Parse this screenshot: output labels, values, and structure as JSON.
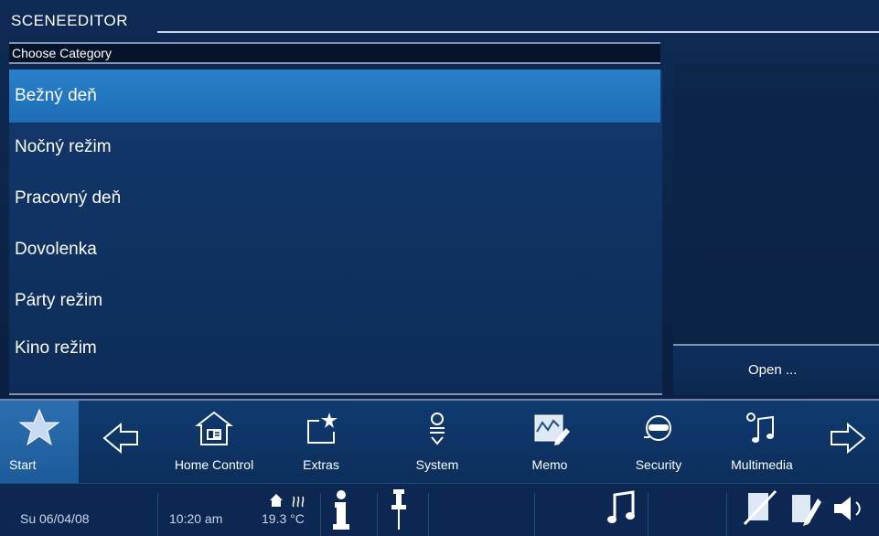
{
  "app": {
    "title": "SCENEEDITOR",
    "subtitle": "Choose Category"
  },
  "categories": [
    {
      "label": "Bežný deň",
      "selected": true
    },
    {
      "label": "Nočný režim",
      "selected": false
    },
    {
      "label": "Pracovný deň",
      "selected": false
    },
    {
      "label": "Dovolenka",
      "selected": false
    },
    {
      "label": "Párty režim",
      "selected": false
    },
    {
      "label": "Kino režim",
      "selected": false
    }
  ],
  "actions": {
    "open_label": "Open ..."
  },
  "navbar": {
    "start_label": "Start",
    "items": [
      {
        "label": "Home Control",
        "icon": "home-control-icon"
      },
      {
        "label": "Extras",
        "icon": "extras-icon"
      },
      {
        "label": "System",
        "icon": "system-icon"
      },
      {
        "label": "Memo",
        "icon": "memo-icon"
      },
      {
        "label": "Security",
        "icon": "security-icon"
      },
      {
        "label": "Multimedia",
        "icon": "multimedia-icon"
      }
    ]
  },
  "status": {
    "date": "Su 06/04/08",
    "time": "10:20 am",
    "temperature": "19.3 °C"
  },
  "colors": {
    "background": "#0b2347",
    "selected": "#2275be",
    "accent": "#7f93b3"
  }
}
